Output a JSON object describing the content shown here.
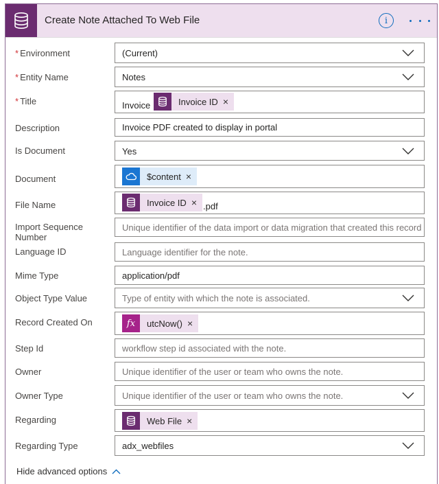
{
  "action": {
    "title": "Create Note Attached To Web File",
    "info_icon": "i",
    "more_icon": "ellipsis-icon"
  },
  "fields": {
    "environment": {
      "label": "Environment",
      "required": "*",
      "value": "(Current)"
    },
    "entity_name": {
      "label": "Entity Name",
      "required": "*",
      "value": "Notes"
    },
    "title": {
      "label": "Title",
      "required": "*",
      "prefix_text": "Invoice",
      "token": "Invoice ID"
    },
    "description": {
      "label": "Description",
      "value": "Invoice PDF created to display in portal"
    },
    "is_document": {
      "label": "Is Document",
      "value": "Yes"
    },
    "document": {
      "label": "Document",
      "token": "$content"
    },
    "file_name": {
      "label": "File Name",
      "token": "Invoice ID",
      "suffix_text": ".pdf"
    },
    "import_sequence": {
      "label": "Import Sequence Number",
      "placeholder": "Unique identifier of the data import or data migration that created this record."
    },
    "language_id": {
      "label": "Language ID",
      "placeholder": "Language identifier for the note."
    },
    "mime_type": {
      "label": "Mime Type",
      "value": "application/pdf"
    },
    "object_type": {
      "label": "Object Type Value",
      "placeholder": "Type of entity with which the note is associated."
    },
    "record_created": {
      "label": "Record Created On",
      "token": "utcNow()",
      "token_icon": "fx"
    },
    "step_id": {
      "label": "Step Id",
      "placeholder": "workflow step id associated with the note."
    },
    "owner": {
      "label": "Owner",
      "placeholder": "Unique identifier of the user or team who owns the note."
    },
    "owner_type": {
      "label": "Owner Type",
      "placeholder": "Unique identifier of the user or team who owns the note."
    },
    "regarding": {
      "label": "Regarding",
      "token": "Web File"
    },
    "regarding_type": {
      "label": "Regarding Type",
      "value": "adx_webfiles"
    }
  },
  "footer": {
    "hide_advanced": "Hide advanced options"
  },
  "token_remove": "×",
  "colors": {
    "accent": "#6b2c70",
    "header_bg": "#eedfee",
    "link": "#0f6cbd",
    "required": "#d13438",
    "dynamic_blue": "#1b76d2",
    "expression": "#a6238a"
  }
}
